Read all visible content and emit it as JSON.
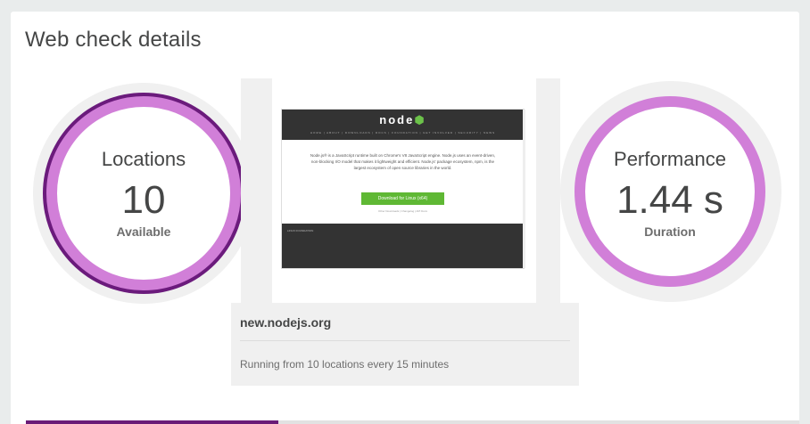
{
  "page": {
    "title": "Web check details"
  },
  "locations": {
    "title": "Locations",
    "value": "10",
    "label": "Available"
  },
  "performance": {
    "title": "Performance",
    "value": "1.44 s",
    "label": "Duration"
  },
  "screenshot": {
    "logo": "node",
    "nav": "HOME | ABOUT | DOWNLOADS | DOCS | FOUNDATION | GET INVOLVED | SECURITY | NEWS",
    "text": "Node.js® is a JavaScript runtime built on Chrome's V8 JavaScript engine. Node.js uses an event-driven, non-blocking I/O model that makes it lightweight and efficient. Node.js' package ecosystem, npm, is the largest ecosystem of open source libraries in the world.",
    "download_button": "Download for Linux (x64)",
    "other_links": "Other Downloads | Changelog | API Docs",
    "footer": "LINUX FOUNDATION"
  },
  "site": {
    "name": "new.nodejs.org",
    "schedule": "Running from 10 locations every 15 minutes"
  },
  "colors": {
    "ring": "#d17fd8",
    "ring_dark": "#6b1b7c",
    "accent": "#6a1b77"
  }
}
